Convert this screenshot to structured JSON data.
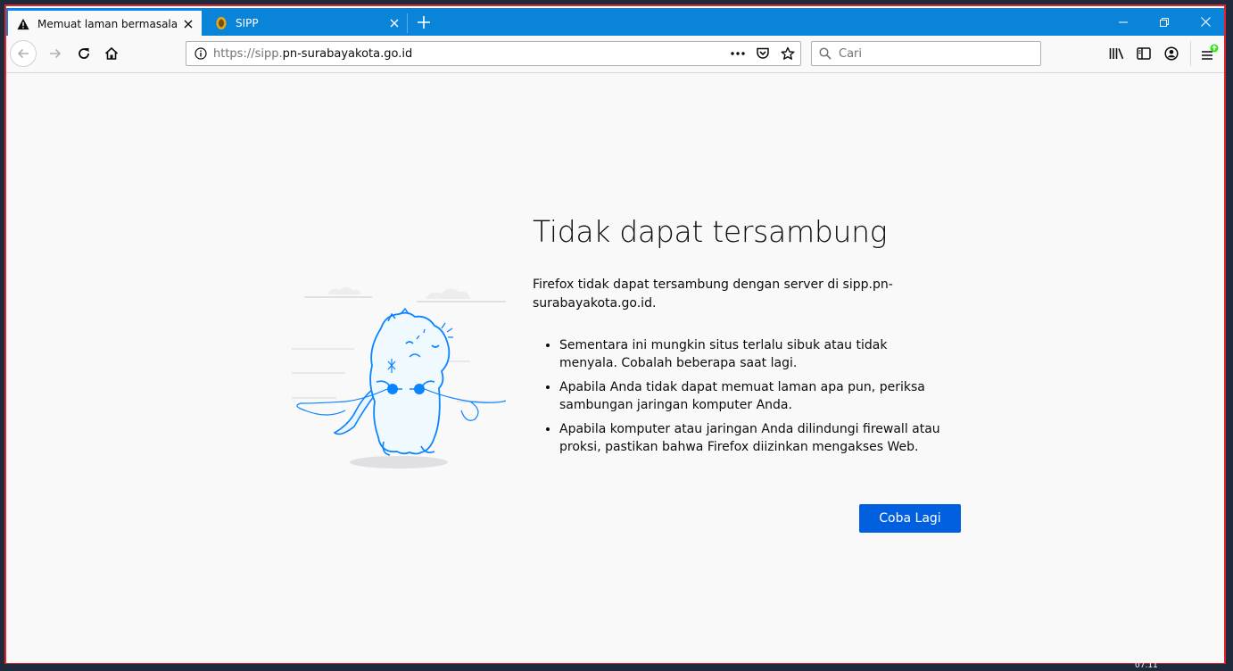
{
  "tabs": [
    {
      "label": "Memuat laman bermasalah",
      "icon": "warning-icon",
      "active": true
    },
    {
      "label": "SIPP",
      "icon": "court-logo-icon",
      "active": false
    }
  ],
  "urlbar": {
    "prefix": "https://sipp.",
    "domain": "pn-surabayakota.go.id"
  },
  "search": {
    "placeholder": "Cari"
  },
  "error": {
    "title": "Tidak dapat tersambung",
    "description": "Firefox tidak dapat tersambung dengan server di sipp.pn-surabayakota.go.id.",
    "bullets": [
      "Sementara ini mungkin situs terlalu sibuk atau tidak menyala. Cobalah beberapa saat lagi.",
      "Apabila Anda tidak dapat memuat laman apa pun, periksa sambungan jaringan komputer Anda.",
      "Apabila komputer atau jaringan Anda dilindungi firewall atau proksi, pastikan bahwa Firefox diizinkan mengakses Web."
    ],
    "retry_label": "Coba Lagi"
  },
  "taskbar": {
    "clock": "07.11"
  },
  "colors": {
    "accent": "#0a84d8",
    "button": "#0060df",
    "illustration": "#0a84ff"
  }
}
